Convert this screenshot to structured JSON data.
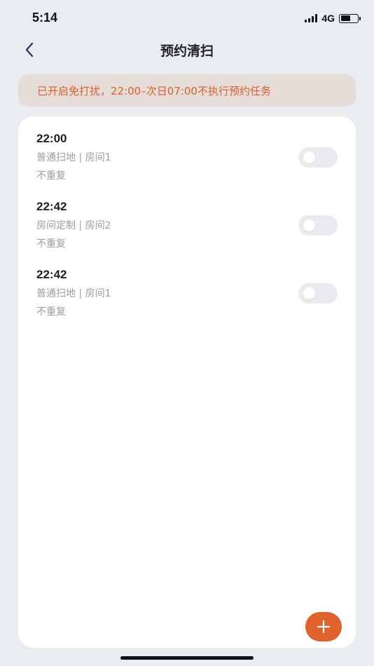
{
  "status_bar": {
    "time": "5:14",
    "network": "4G",
    "battery_level": 0.6
  },
  "header": {
    "title": "预约清扫",
    "back_icon": "chevron-left-icon"
  },
  "banner": {
    "text": "已开启免打扰，22:00–次日07:00不执行预约任务"
  },
  "schedules": [
    {
      "time": "22:00",
      "description": "普通扫地 | 房间1",
      "repeat": "不重复",
      "enabled": false
    },
    {
      "time": "22:42",
      "description": "房间定制 | 房间2",
      "repeat": "不重复",
      "enabled": false
    },
    {
      "time": "22:42",
      "description": "普通扫地 | 房间1",
      "repeat": "不重复",
      "enabled": false
    }
  ],
  "fab": {
    "icon": "plus-icon"
  },
  "colors": {
    "accent": "#e0622d",
    "banner_text": "#d9602e",
    "banner_bg": "#e6dcd8",
    "page_bg": "#e9ecf1"
  }
}
